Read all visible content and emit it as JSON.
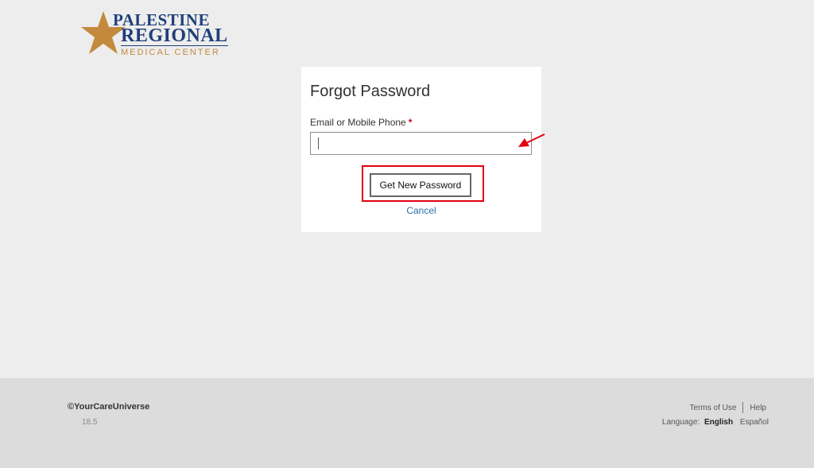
{
  "logo": {
    "line1": "PALESTINE",
    "line2": "REGIONAL",
    "line3": "MEDICAL CENTER",
    "star_color": "#c38a3d",
    "text_color": "#1f3f7a"
  },
  "form": {
    "title": "Forgot Password",
    "field_label": "Email or Mobile Phone",
    "required_marker": "*",
    "field_value": "",
    "submit_label": "Get New Password",
    "cancel_label": "Cancel"
  },
  "annotations": {
    "highlight_color": "#e3000f",
    "arrow_color": "#e3000f"
  },
  "footer": {
    "copyright": "©YourCareUniverse",
    "version": "18.5",
    "terms_label": "Terms of Use",
    "help_label": "Help",
    "language_label": "Language:",
    "language_active": "English",
    "language_alt": "Español"
  }
}
